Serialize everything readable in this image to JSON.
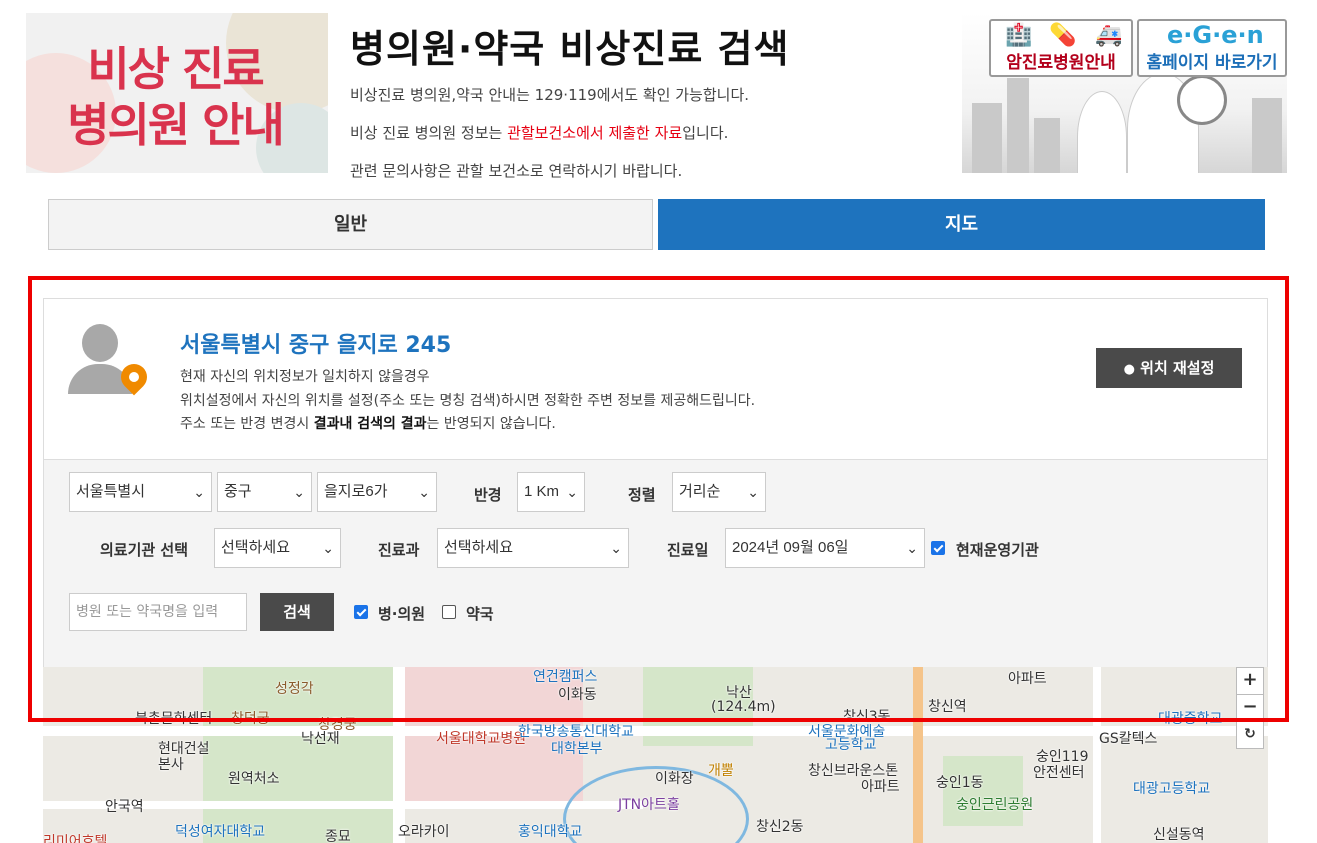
{
  "header": {
    "banner_text": "비상 진료\n병의원 안내",
    "title": "병의원·약국 비상진료 검색",
    "info_line1": "비상진료 병의원,약국 안내는 129·119에서도 확인 가능합니다.",
    "info_line2_pre": "비상 진료 병의원 정보는 ",
    "info_line2_red": "관할보건소에서 제출한 자료",
    "info_line2_post": "입니다.",
    "info_line3": "관련 문의사항은 관할 보건소로 연락하시기 바랍니다.",
    "cancer_hospital_label": "암진료병원안내",
    "homepage_label": "홈페이지 바로가기"
  },
  "tabs": [
    {
      "label": "일반",
      "active": false
    },
    {
      "label": "지도",
      "active": true
    }
  ],
  "location": {
    "address": "서울특별시 중구 을지로 245",
    "desc1": "현재 자신의 위치정보가 일치하지 않을경우",
    "desc2": "위치설정에서 자신의 위치를 설정(주소 또는 명칭 검색)하시면 정확한 주변 정보를 제공해드립니다.",
    "desc3_pre": "주소 또는 반경 변경시 ",
    "desc3_bold": "결과내 검색의 결과",
    "desc3_post": "는 반영되지 않습니다.",
    "reset_button": "위치 재설정"
  },
  "filters": {
    "city": "서울특별시",
    "district": "중구",
    "dong": "을지로6가",
    "radius_label": "반경",
    "radius": "1 Km",
    "sort_label": "정렬",
    "sort": "거리순",
    "institution_label": "의료기관 선택",
    "institution": "선택하세요",
    "department_label": "진료과",
    "department": "선택하세요",
    "date_label": "진료일",
    "date": "2024년 09월 06일",
    "operating_label": "현재운영기관",
    "operating_checked": true,
    "search_placeholder": "병원 또는 약국명을 입력",
    "search_button": "검색",
    "hospital_label": "병·의원",
    "hospital_checked": true,
    "pharmacy_label": "약국",
    "pharmacy_checked": false
  },
  "map": {
    "labels": [
      "연건캠퍼스",
      "이화동",
      "낙산",
      "(124.4m)",
      "아파트",
      "창신역",
      "성정각",
      "서울대학교병원",
      "한국방송통신대학교",
      "대학본부",
      "서울문화예술",
      "고등학교",
      "창신3동",
      "대광중학교",
      "북촌문화센터",
      "창덕궁",
      "창경궁",
      "낙선재",
      "현대건설",
      "본사",
      "원역처소",
      "이화장",
      "개뿔",
      "창신브라운스톤",
      "아파트",
      "숭인1동",
      "숭인119",
      "안전센터",
      "GS칼텍스",
      "대광고등학교",
      "숭인근린공원",
      "안국역",
      "JTN아트홀",
      "덕성여자대학교",
      "종묘",
      "오라카이",
      "홍익대학교",
      "창신2동",
      "신설동역",
      "리미어호텔"
    ],
    "zoom_in": "+",
    "zoom_out": "−",
    "refresh": "↻"
  },
  "colors": {
    "accent": "#1e73be",
    "alert": "#e60012",
    "highlight_border": "#ee0000",
    "button_dark": "#4a4a4a"
  }
}
